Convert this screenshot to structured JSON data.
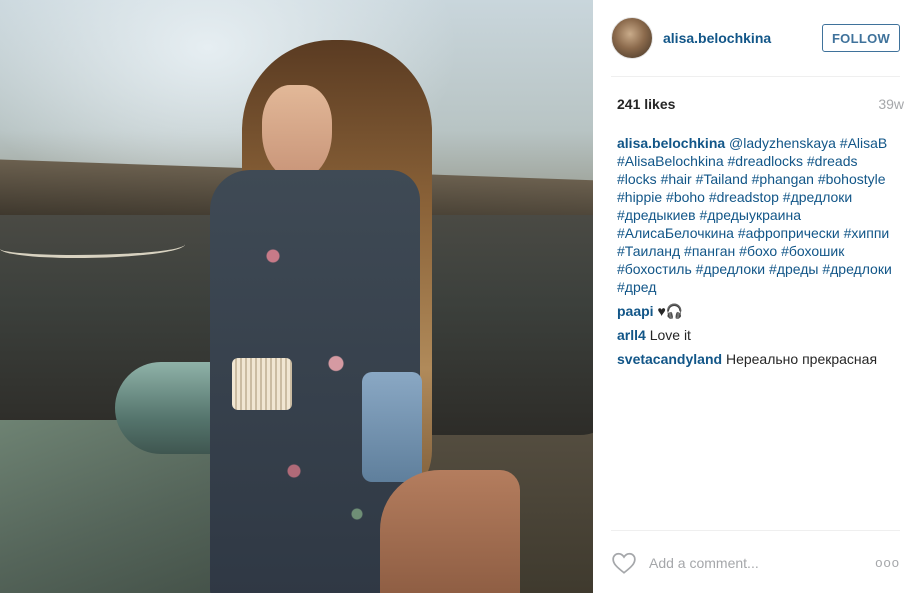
{
  "header": {
    "username": "alisa.belochkina",
    "follow_label": "FOLLOW"
  },
  "stats": {
    "likes": "241 likes",
    "age": "39w"
  },
  "caption": {
    "user": "alisa.belochkina",
    "text": " @ladyzhenskaya #AlisaB #AlisaBelochkina #dreadlocks #dreads #locks #hair #Tailand #phangan #bohostyle #hippie #boho #dreadstop #дредлоки #дредыкиев #дредыукраина #АлисаБелочкина #афропрически #хиппи #Таиланд #панган #бохо #бохошик #бохостиль #дредлоки #дреды #дредлоки #дред"
  },
  "comments": [
    {
      "user": "paapi",
      "text": " ♥🎧"
    },
    {
      "user": "arll4",
      "text": " Love it"
    },
    {
      "user": "svetacandyland",
      "text": " Нереально прекрасная"
    }
  ],
  "footer": {
    "add_comment_placeholder": "Add a comment...",
    "more_label": "ooo"
  },
  "icons": {
    "like": "heart-outline-icon",
    "more": "more-options-icon"
  },
  "colors": {
    "link": "#125688",
    "follow": "#3f729b",
    "muted": "#a5a7aa"
  }
}
